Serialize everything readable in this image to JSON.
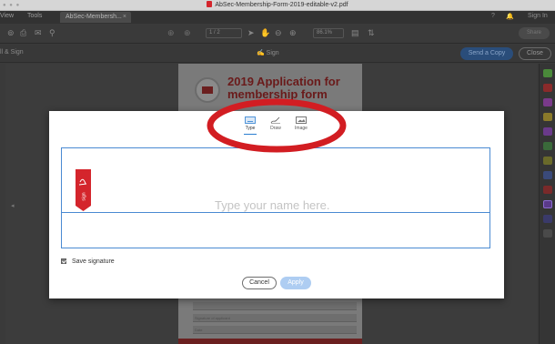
{
  "window": {
    "title": "AbSec-Membership-Form-2019-editable-v2.pdf"
  },
  "tabs": {
    "view": "View",
    "tools": "Tools",
    "document": "AbSec-Membersh...",
    "close_glyph": "×",
    "help_glyph": "?",
    "bell_glyph": "🔔",
    "sign_in": "Sign In"
  },
  "toolbar": {
    "page_label": "1  / 2",
    "zoom_label": "86.1%",
    "share_label": "Share"
  },
  "signbar": {
    "left_label": "ll & Sign",
    "center_label": "Sign",
    "send_copy": "Send a Copy",
    "close": "Close"
  },
  "document": {
    "heading_line1": "2019 Application for",
    "heading_line2": "membership form",
    "fields": [
      "Signature of applicant",
      "Date"
    ]
  },
  "dialog": {
    "modes": [
      {
        "label": "Type",
        "icon": "keyboard-icon",
        "active": true
      },
      {
        "label": "Draw",
        "icon": "pen-icon",
        "active": false
      },
      {
        "label": "Image",
        "icon": "image-icon",
        "active": false
      }
    ],
    "placeholder": "Type your name here.",
    "save_signature": "Save signature",
    "save_checked": true,
    "cancel": "Cancel",
    "apply": "Apply"
  },
  "colors": {
    "accent": "#2a7dd1",
    "annotation": "#d21d22",
    "acrobat_red": "#d4252c"
  }
}
